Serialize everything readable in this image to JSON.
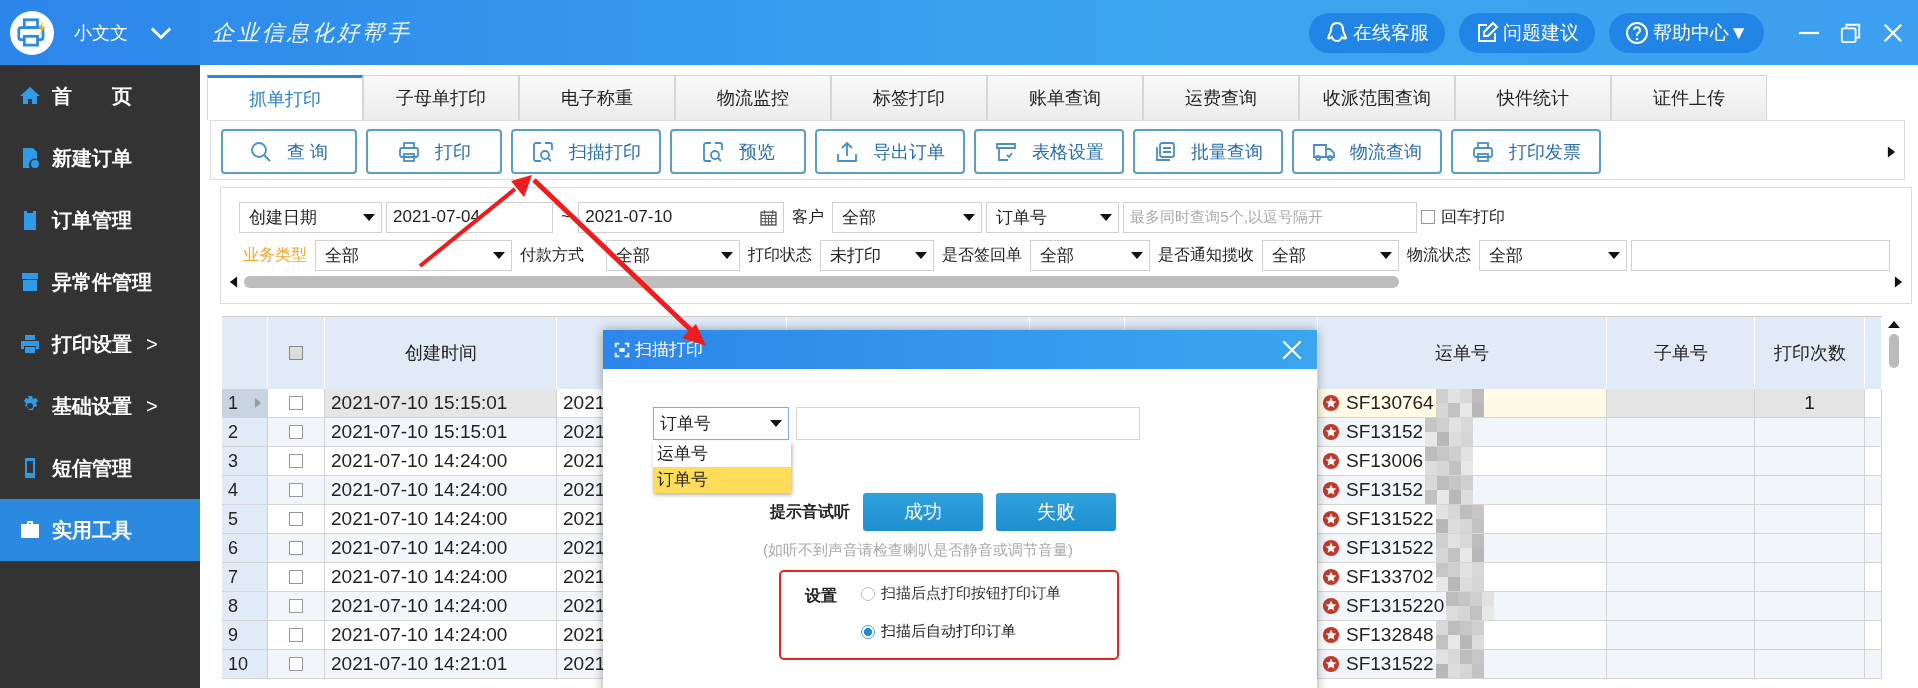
{
  "app": {
    "user": "小文文",
    "slogan": "企业信息化好帮手"
  },
  "header_buttons": [
    {
      "label": "在线客服"
    },
    {
      "label": "问题建议"
    },
    {
      "label": "帮助中心▼"
    }
  ],
  "sidebar": {
    "items": [
      {
        "label": "首　　页",
        "selected": false
      },
      {
        "label": "新建订单",
        "selected": false
      },
      {
        "label": "订单管理",
        "selected": false
      },
      {
        "label": "异常件管理",
        "selected": false
      },
      {
        "label": "打印设置",
        "chevron": ">",
        "selected": false
      },
      {
        "label": "基础设置",
        "chevron": ">",
        "selected": false
      },
      {
        "label": "短信管理",
        "selected": false
      },
      {
        "label": "实用工具",
        "selected": true
      }
    ]
  },
  "tabs": [
    {
      "label": "抓单打印",
      "selected": true
    },
    {
      "label": "子母单打印",
      "selected": false
    },
    {
      "label": "电子称重",
      "selected": false
    },
    {
      "label": "物流监控",
      "selected": false
    },
    {
      "label": "标签打印",
      "selected": false
    },
    {
      "label": "账单查询",
      "selected": false
    },
    {
      "label": "运费查询",
      "selected": false
    },
    {
      "label": "收派范围查询",
      "selected": false
    },
    {
      "label": "快件统计",
      "selected": false
    },
    {
      "label": "证件上传",
      "selected": false
    }
  ],
  "toolbar": [
    "查 询",
    "打印",
    "扫描打印",
    "预览",
    "导出订单",
    "表格设置",
    "批量查询",
    "物流查询",
    "打印发票"
  ],
  "filters": [
    [
      {
        "kind": "select",
        "value": "创建日期"
      },
      {
        "kind": "date",
        "value": "2021-07-04"
      },
      {
        "kind": "label",
        "text": "~",
        "highlight": false
      },
      {
        "kind": "date",
        "value": "2021-07-10",
        "calendar": true
      },
      {
        "kind": "label",
        "text": "客户",
        "highlight": false
      },
      {
        "kind": "select",
        "value": "全部"
      },
      {
        "kind": "select",
        "value": "订单号"
      },
      {
        "kind": "input",
        "placeholder": "最多同时查询5个,以逗号隔开"
      },
      {
        "kind": "checkbox",
        "text": "回车打印",
        "checked": false
      }
    ],
    [
      {
        "kind": "label",
        "text": "业务类型",
        "highlight": true
      },
      {
        "kind": "select",
        "value": "全部"
      },
      {
        "kind": "label",
        "text": "付款方式",
        "highlight": false
      },
      {
        "kind": "select",
        "value": "全部"
      },
      {
        "kind": "label",
        "text": "打印状态",
        "highlight": false
      },
      {
        "kind": "select",
        "value": "未打印"
      },
      {
        "kind": "label",
        "text": "是否签回单",
        "highlight": false
      },
      {
        "kind": "select",
        "value": "全部"
      },
      {
        "kind": "label",
        "text": "是否通知揽收",
        "highlight": false
      },
      {
        "kind": "select",
        "value": "全部"
      },
      {
        "kind": "label",
        "text": "物流状态",
        "highlight": false
      },
      {
        "kind": "select",
        "value": "全部"
      },
      {
        "kind": "input"
      }
    ]
  ],
  "table": {
    "select_all_checked": false,
    "columns": [
      {
        "label": "创建时间"
      },
      {
        "label": "运单号"
      },
      {
        "label": "子单号"
      },
      {
        "label": "打印次数"
      }
    ],
    "rows": [
      {
        "number": "1",
        "checked": false,
        "selected": true,
        "created": "2021-07-10 15:15:01",
        "column_2": "2021",
        "waybill": "SF130764",
        "print_count": "1"
      },
      {
        "number": "2",
        "checked": false,
        "selected": false,
        "created": "2021-07-10 15:15:01",
        "column_2": "2021",
        "waybill": "SF13152"
      },
      {
        "number": "3",
        "checked": false,
        "selected": false,
        "created": "2021-07-10 14:24:00",
        "column_2": "2021",
        "waybill": "SF13006"
      },
      {
        "number": "4",
        "checked": false,
        "selected": false,
        "created": "2021-07-10 14:24:00",
        "column_2": "2021",
        "waybill": "SF13152"
      },
      {
        "number": "5",
        "checked": false,
        "selected": false,
        "created": "2021-07-10 14:24:00",
        "column_2": "2021",
        "waybill": "SF131522"
      },
      {
        "number": "6",
        "checked": false,
        "selected": false,
        "created": "2021-07-10 14:24:00",
        "column_2": "2021",
        "waybill": "SF131522"
      },
      {
        "number": "7",
        "checked": false,
        "selected": false,
        "created": "2021-07-10 14:24:00",
        "column_2": "2021",
        "waybill": "SF133702"
      },
      {
        "number": "8",
        "checked": false,
        "selected": false,
        "created": "2021-07-10 14:24:00",
        "column_2": "2021",
        "waybill": "SF1315220"
      },
      {
        "number": "9",
        "checked": false,
        "selected": false,
        "created": "2021-07-10 14:24:00",
        "column_2": "2021",
        "waybill": "SF132848"
      },
      {
        "number": "10",
        "checked": false,
        "selected": false,
        "created": "2021-07-10 14:21:01",
        "column_2": "2021",
        "waybill": "SF131522"
      }
    ]
  },
  "dialog": {
    "title": "扫描打印",
    "select_value": "订单号",
    "options": [
      {
        "label": "运单号",
        "selected": false
      },
      {
        "label": "订单号",
        "selected": true
      }
    ],
    "sound_label": "提示音试听",
    "buttons": [
      "成功",
      "失败"
    ],
    "hint": "(如听不到声音请检查喇叭是否静音或调节音量)",
    "settings_label": "设置",
    "radios": [
      {
        "label": "扫描后点打印按钮打印订单",
        "selected": false
      },
      {
        "label": "扫描后自动打印订单",
        "selected": true
      }
    ]
  }
}
